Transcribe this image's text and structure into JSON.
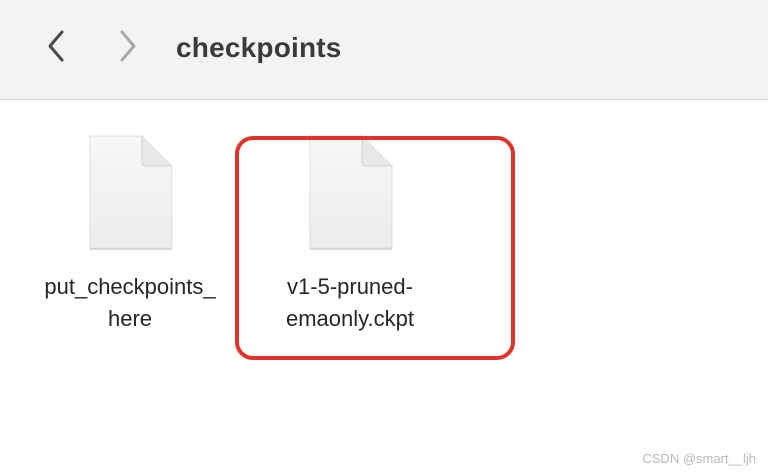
{
  "toolbar": {
    "back_icon": "chevron-left-icon",
    "forward_icon": "chevron-right-icon",
    "folder_title": "checkpoints"
  },
  "files": [
    {
      "name_line1": "put_checkpoints_",
      "name_line2": "here",
      "icon": "document-icon"
    },
    {
      "name_line1": "v1-5-pruned-",
      "name_line2": "emaonly.ckpt",
      "icon": "document-icon"
    }
  ],
  "highlight": {
    "color": "#e0342b"
  },
  "watermark": "CSDN @smart__ljh"
}
